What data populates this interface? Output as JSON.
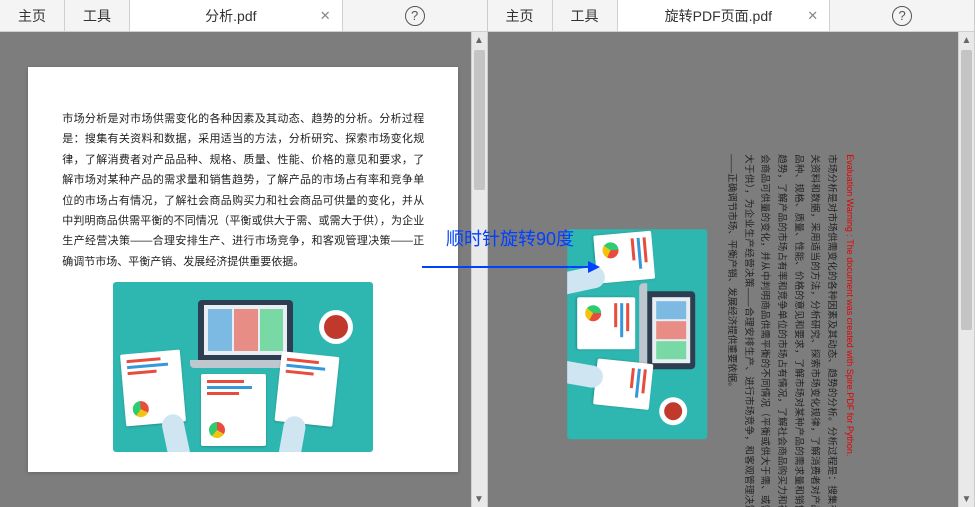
{
  "left": {
    "toolbar": {
      "home": "主页",
      "tools": "工具",
      "tab_label": "分析.pdf",
      "help": "?"
    },
    "page_text": "市场分析是对市场供需变化的各种因素及其动态、趋势的分析。分析过程是：搜集有关资料和数据，采用适当的方法，分析研究、探索市场变化规律，了解消费者对产品品种、规格、质量、性能、价格的意见和要求，了解市场对某种产品的需求量和销售趋势，了解产品的市场占有率和竞争单位的市场占有情况，了解社会商品购买力和社会商品可供量的变化，并从中判明商品供需平衡的不同情况（平衡或供大于需、或需大于供），为企业生产经营决策——合理安排生产、进行市场竞争，和客观管理决策——正确调节市场、平衡产销、发展经济提供重要依据。"
  },
  "right": {
    "toolbar": {
      "home": "主页",
      "tools": "工具",
      "tab_label": "旋转PDF页面.pdf",
      "help": "?"
    },
    "eval_warning": "Evaluation Warning : The document was created with Spire.PDF for Python.",
    "page_text": "市场分析是对市场供需变化的各种因素及其动态、趋势的分析。分析过程是：搜集有关资料和数据，采用适当的方法，分析研究、探索市场变化规律，了解消费者对产品品种、规格、质量、性能、价格的意见和要求，了解市场对某种产品的需求量和销售趋势，了解产品的市场占有率和竞争单位的市场占有情况，了解社会商品购买力和社会商品可供量的变化，并从中判明商品供需平衡的不同情况（平衡或供大于需、或需大于供），为企业生产经营决策——合理安排生产、进行市场竞争，和客观管理决策——正确调节市场、平衡产销、发展经济提供重要依据。"
  },
  "arrow_label": "顺时针旋转90度"
}
